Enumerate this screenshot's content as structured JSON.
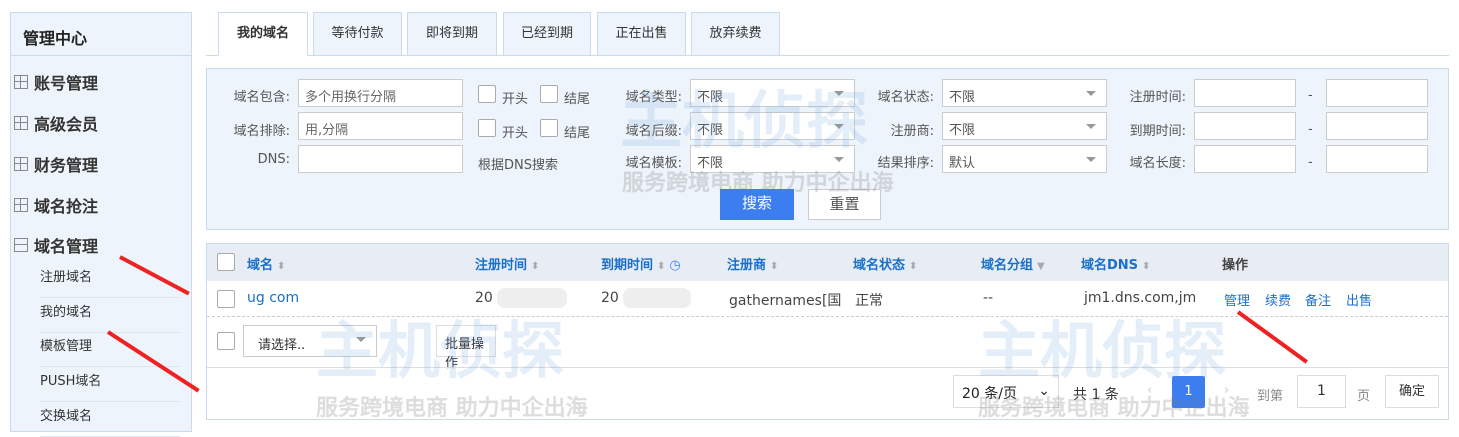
{
  "sidebar": {
    "title": "管理中心",
    "items": [
      {
        "label": "账号管理"
      },
      {
        "label": "高级会员"
      },
      {
        "label": "财务管理"
      },
      {
        "label": "域名抢注"
      },
      {
        "label": "域名管理"
      }
    ],
    "subitems": [
      {
        "label": "注册域名"
      },
      {
        "label": "我的域名"
      },
      {
        "label": "模板管理"
      },
      {
        "label": "PUSH域名"
      },
      {
        "label": "交换域名"
      }
    ]
  },
  "tabs": [
    {
      "label": "我的域名"
    },
    {
      "label": "等待付款"
    },
    {
      "label": "即将到期"
    },
    {
      "label": "已经到期"
    },
    {
      "label": "正在出售"
    },
    {
      "label": "放弃续费"
    }
  ],
  "filter": {
    "contains_label": "域名包含:",
    "contains_placeholder": "多个用换行分隔",
    "exclude_label": "域名排除:",
    "exclude_placeholder": "用,分隔",
    "dns_label": "DNS:",
    "start": "开头",
    "end": "结尾",
    "dns_search": "根据DNS搜索",
    "type_label": "域名类型:",
    "type_value": "不限",
    "suffix_label": "域名后缀:",
    "suffix_value": "不限",
    "template_label": "域名模板:",
    "template_value": "不限",
    "status_label": "域名状态:",
    "status_value": "不限",
    "registrar_label": "注册商:",
    "registrar_value": "不限",
    "sort_label": "结果排序:",
    "sort_value": "默认",
    "reg_time_label": "注册时间:",
    "exp_time_label": "到期时间:",
    "length_label": "域名长度:",
    "dash": "-",
    "search": "搜索",
    "reset": "重置"
  },
  "table": {
    "headers": [
      "域名",
      "注册时间",
      "到期时间",
      "注册商",
      "域名状态",
      "域名分组",
      "域名DNS",
      "操作"
    ],
    "rows": [
      {
        "domain": "ug     com",
        "reg": "20",
        "exp": "20",
        "registrar": "gathernames[国",
        "status": "正常",
        "group": "--",
        "dns": "jm1.dns.com,jm",
        "actions": [
          "管理",
          "续费",
          "备注",
          "出售"
        ]
      }
    ],
    "batch_select": "请选择..",
    "batch_button": "批量操作"
  },
  "pagination": {
    "per_page": "20 条/页",
    "total": "共 1 条",
    "current": "1",
    "goto": "到第",
    "page_input": "1",
    "page_unit": "页",
    "confirm": "确定"
  },
  "watermark": {
    "brand": "主机侦探",
    "slogan": "服务跨境电商 助力中企出海"
  }
}
